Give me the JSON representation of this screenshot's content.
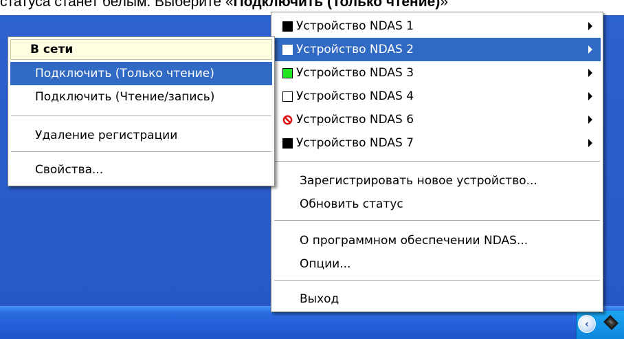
{
  "caption": {
    "prefix": "статуса станет белым. Выберите «",
    "bold": "Подключить (Только чтение)",
    "suffix": "»"
  },
  "main_menu": {
    "devices": [
      {
        "label": "Устройство NDAS 1",
        "status": "black"
      },
      {
        "label": "Устройство NDAS 2",
        "status": "white"
      },
      {
        "label": "Устройство NDAS 3",
        "status": "green"
      },
      {
        "label": "Устройство NDAS 4",
        "status": "white"
      },
      {
        "label": "Устройство NDAS 6",
        "status": "forbidden"
      },
      {
        "label": "Устройство NDAS 7",
        "status": "black"
      }
    ],
    "register": "Зарегистрировать новое устройство...",
    "refresh": "Обновить статус",
    "about": "О программном обеспечении NDAS...",
    "options": "Опции...",
    "exit": "Выход"
  },
  "sub_menu": {
    "header": "В сети",
    "connect_ro": "Подключить (Только чтение)",
    "connect_rw": "Подключить (Чтение/запись)",
    "unregister": "Удаление регистрации",
    "properties": "Свойства..."
  },
  "tray": {
    "chevron_icon": "chevron-left-icon",
    "device_icon": "ndas-device-icon"
  },
  "colors": {
    "highlight": "#316ac5",
    "header_bg": "#ffffe1",
    "desktop": "#2a5ec8",
    "status_green": "#22e522"
  }
}
